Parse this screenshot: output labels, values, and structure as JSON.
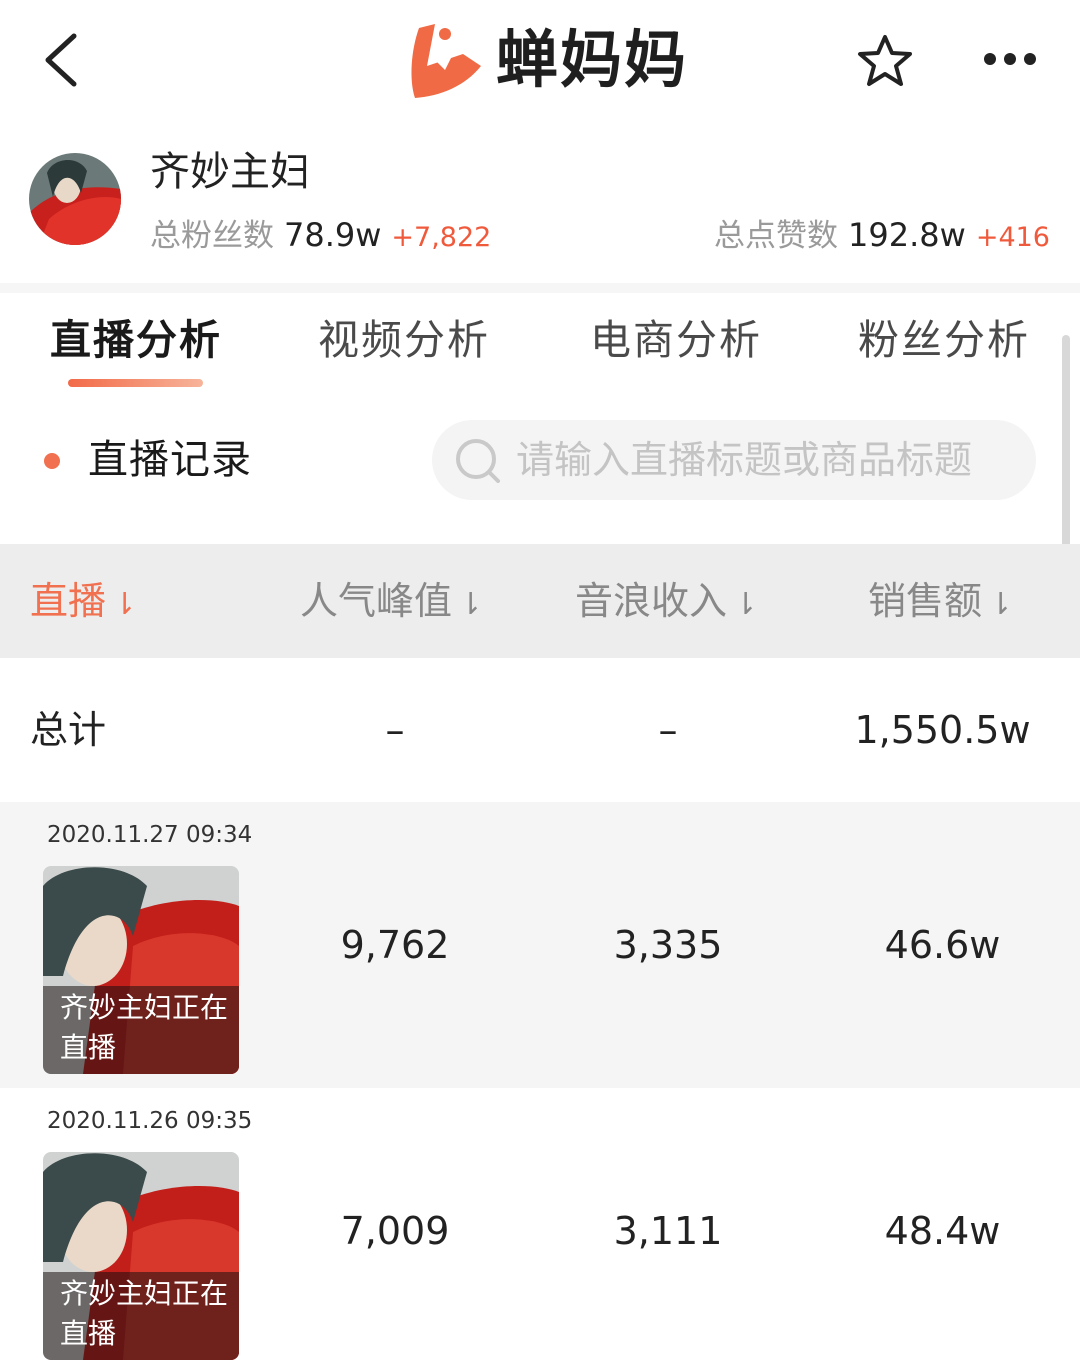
{
  "header": {
    "brand": "蝉妈妈"
  },
  "profile": {
    "name": "齐妙主妇",
    "fans_label": "总粉丝数",
    "fans_value": "78.9w",
    "fans_delta": "+7,822",
    "likes_label": "总点赞数",
    "likes_value": "192.8w",
    "likes_delta": "+416"
  },
  "tabs": [
    {
      "label": "直播分析",
      "active": true
    },
    {
      "label": "视频分析",
      "active": false
    },
    {
      "label": "电商分析",
      "active": false
    },
    {
      "label": "粉丝分析",
      "active": false
    }
  ],
  "records": {
    "title": "直播记录",
    "search_placeholder": "请输入直播标题或商品标题"
  },
  "table": {
    "headers": [
      {
        "label": "直播",
        "arrow": "⇂",
        "active": true
      },
      {
        "label": "人气峰值",
        "arrow": "⇂",
        "active": false
      },
      {
        "label": "音浪收入",
        "arrow": "⇂",
        "active": false
      },
      {
        "label": "销售额",
        "arrow": "⇂",
        "active": false
      }
    ],
    "total": {
      "label": "总计",
      "peak": "–",
      "income": "–",
      "sales": "1,550.5w"
    },
    "rows": [
      {
        "datetime": "2020.11.27 09:34",
        "thumb_title": "齐妙主妇正在直播",
        "peak": "9,762",
        "income": "3,335",
        "sales": "46.6w"
      },
      {
        "datetime": "2020.11.26 09:35",
        "thumb_title": "齐妙主妇正在直播",
        "peak": "7,009",
        "income": "3,111",
        "sales": "48.4w"
      }
    ]
  },
  "colors": {
    "accent": "#f0704f",
    "delta": "#f05a3c",
    "header_bg": "#ededed"
  }
}
